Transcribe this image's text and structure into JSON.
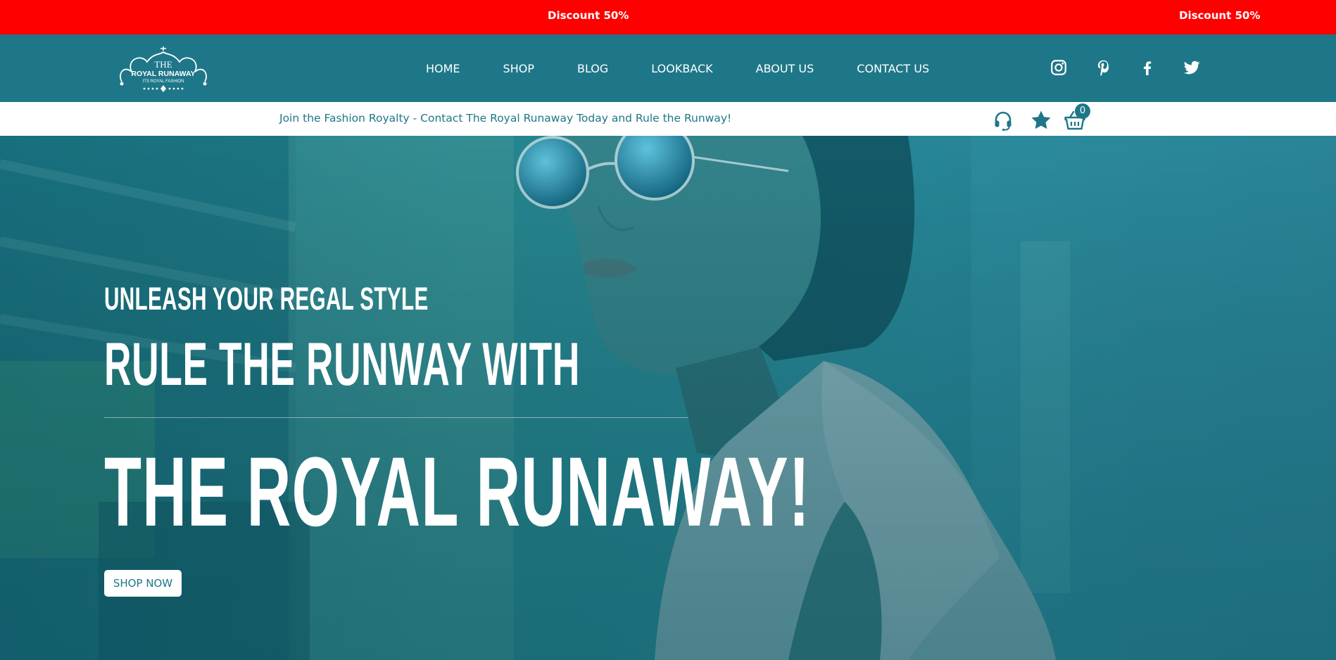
{
  "promo": {
    "text_left": "Discount 50%",
    "text_right": "Discount 50%",
    "background_color": "#ff0000"
  },
  "header": {
    "logo": {
      "line1": "THE",
      "line2": "ROYAL RUNAWAY",
      "line3": "ITS ROYAL FASHION"
    },
    "nav": {
      "home": "HOME",
      "shop": "SHOP",
      "blog": "BLOG",
      "lookback": "LOOKBACK",
      "about": "ABOUT US",
      "contact": "CONTACT US"
    },
    "social_icons": [
      "instagram-icon",
      "pinterest-icon",
      "facebook-icon",
      "twitter-icon"
    ],
    "background_color": "#1e7788"
  },
  "subbar": {
    "tagline": "Join the Fashion Royalty - Contact The Royal Runaway Today and Rule the Runway!",
    "icons": [
      "headset-icon",
      "star-icon",
      "basket-icon"
    ],
    "cart_count": "0"
  },
  "hero": {
    "eyebrow": "UNLEASH YOUR REGAL STYLE",
    "headline": "RULE THE RUNWAY WITH",
    "brand": "THE ROYAL RUNAWAY!",
    "cta_label": "SHOP NOW"
  },
  "colors": {
    "accent": "#1e7788",
    "white": "#ffffff"
  }
}
